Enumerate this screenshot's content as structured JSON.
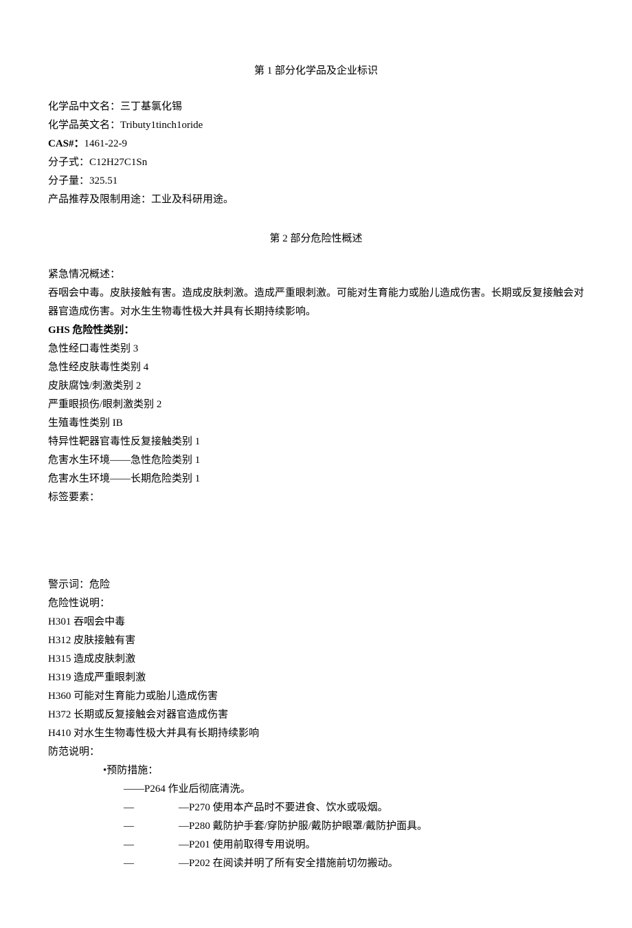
{
  "section1": {
    "title": "第 1 部分化学品及企业标识",
    "name_cn_label": "化学品中文名：",
    "name_cn_value": "三丁基氯化锡",
    "name_en_label": "化学品英文名：",
    "name_en_value": "Tributy1tinch1oride",
    "cas_label": "CAS#：",
    "cas_value": "1461-22-9",
    "formula_label": "分子式：",
    "formula_value": "C12H27C1Sn",
    "mw_label": "分子量：",
    "mw_value": "325.51",
    "use_label": "产品推荐及限制用途：",
    "use_value": "工业及科研用途。"
  },
  "section2": {
    "title": "第 2 部分危险性概述",
    "emergency_label": "紧急情况概述：",
    "emergency_text": "吞咽会中毒。皮肤接触有害。造成皮肤刺激。造成严重眼刺激。可能对生育能力或胎儿造成伤害。长期或反复接触会对器官造成伤害。对水生生物毒性极大并具有长期持续影响。",
    "ghs_label": "GHS 危险性类别：",
    "ghs_items": [
      "急性经口毒性类别 3",
      "急性经皮肤毒性类别 4",
      "皮肤腐蚀/刺激类别 2",
      "严重眼损伤/眼刺激类别 2",
      "生殖毒性类别 IB",
      "特异性靶器官毒性反复接触类别 1",
      "危害水生环境——急性危险类别 1",
      "危害水生环境——长期危险类别 1"
    ],
    "label_elements": "标签要素：",
    "signal_word_label": "警示词：",
    "signal_word_value": "危险",
    "hazard_statements_label": "危险性说明：",
    "hazard_statements": [
      "H301 吞咽会中毒",
      "H312 皮肤接触有害",
      "H315 造成皮肤刺激",
      "H319 造成严重眼刺激",
      "H360 可能对生育能力或胎儿造成伤害",
      "H372 长期或反复接触会对器官造成伤害",
      "H410 对水生生物毒性极大并具有长期持续影响"
    ],
    "precautionary_label": "防范说明：",
    "prevention_label": "•预防措施：",
    "prevention_first": "——P264 作业后彻底清洗。",
    "prevention_items": [
      "—P270 使用本产品时不要进食、饮水或吸烟。",
      "—P280 戴防护手套/穿防护服/戴防护眼罩/戴防护面具。",
      "—P201 使用前取得专用说明。",
      "—P202 在阅读并明了所有安全措施前切勿搬动。"
    ]
  }
}
